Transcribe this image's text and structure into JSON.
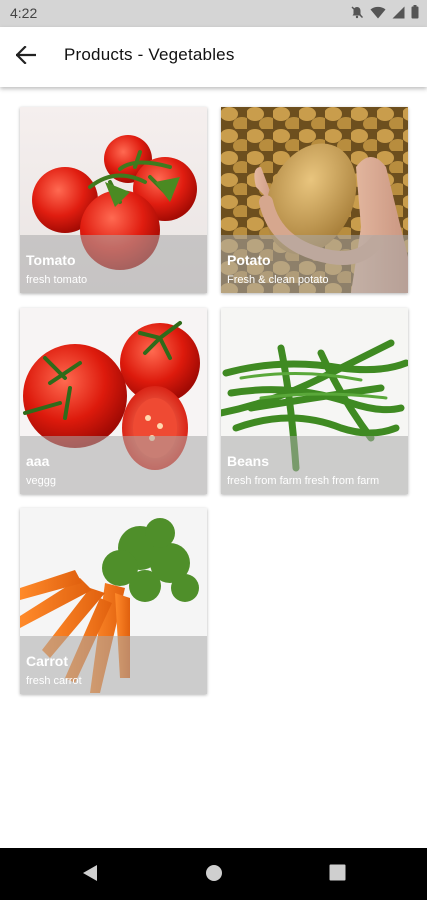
{
  "status_bar": {
    "time": "4:22",
    "icons": [
      "mute-icon",
      "wifi-icon",
      "signal-icon",
      "battery-icon"
    ]
  },
  "app_bar": {
    "back_icon": "arrow-left-icon",
    "title": "Products - Vegetables"
  },
  "products": [
    {
      "name": "Tomato",
      "description": "fresh tomato",
      "image": "tomato-image"
    },
    {
      "name": "Potato",
      "description": "Fresh & clean potato",
      "image": "potato-image"
    },
    {
      "name": "aaa",
      "description": "veggg",
      "image": "tomato-slices-image"
    },
    {
      "name": "Beans",
      "description": "fresh from farm fresh from farm",
      "image": "beans-image"
    },
    {
      "name": "Carrot",
      "description": "fresh carrot",
      "image": "carrot-image"
    }
  ],
  "nav_bar": {
    "icons": [
      "back-triangle-icon",
      "home-circle-icon",
      "recents-square-icon"
    ]
  },
  "colors": {
    "status_bar_bg": "#d5d5d5",
    "nav_bar_bg": "#000000",
    "caption_overlay": "rgba(170,170,170,0.55)"
  }
}
